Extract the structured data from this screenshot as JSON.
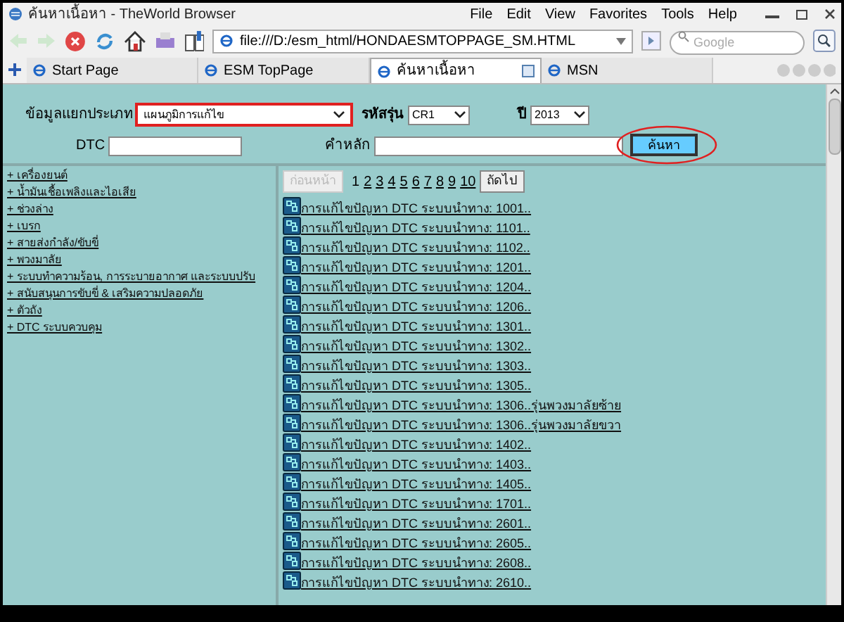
{
  "window": {
    "title": "ค้นหาเนื้อหา - TheWorld Browser"
  },
  "menu": [
    "File",
    "Edit",
    "View",
    "Favorites",
    "Tools",
    "Help"
  ],
  "address": {
    "value": "file:///D:/esm_html/HONDAESMTOPPAGE_SM.HTML"
  },
  "search": {
    "placeholder": "Google"
  },
  "tabs": [
    {
      "label": "Start Page",
      "selected": false
    },
    {
      "label": "ESM TopPage",
      "selected": false
    },
    {
      "label": "ค้นหาเนื้อหา",
      "selected": true
    },
    {
      "label": "MSN",
      "selected": false
    }
  ],
  "form": {
    "category_label": "ข้อมูลแยกประเภท",
    "category_value": "แผนภูมิการแก้ไข",
    "model_label": "รหัสรุ่น",
    "model_value": "CR1",
    "year_label": "ปี",
    "year_value": "2013",
    "dtc_label": "DTC",
    "keyword_label": "คำหลัก",
    "search_button": "ค้นหา"
  },
  "sidebar": {
    "items": [
      "+ เครื่องยนต์",
      "+ น้ำมันเชื้อเพลิงและไอเสีย",
      "+ ช่วงล่าง",
      "+ เบรก",
      "+ สายส่งกำลัง/ขับขี่",
      "+ พวงมาลัย",
      "+ ระบบทำความร้อน, การระบายอากาศ และระบบปรับ",
      "+ สนับสนุนการขับขี่ & เสริมความปลอดภัย",
      "+ ตัวถัง",
      "+ DTC ระบบควบคุม"
    ]
  },
  "pagination": {
    "prev": {
      "label": "ก่อนหน้า",
      "disabled": true
    },
    "pages": [
      "1",
      "2",
      "3",
      "4",
      "5",
      "6",
      "7",
      "8",
      "9",
      "10"
    ],
    "next": {
      "label": "ถัดไป",
      "disabled": false
    }
  },
  "results": [
    "การแก้ไขปัญหา DTC ระบบนำทาง: 1001..",
    "การแก้ไขปัญหา DTC ระบบนำทาง: 1101..",
    "การแก้ไขปัญหา DTC ระบบนำทาง: 1102..",
    "การแก้ไขปัญหา DTC ระบบนำทาง: 1201..",
    "การแก้ไขปัญหา DTC ระบบนำทาง: 1204..",
    "การแก้ไขปัญหา DTC ระบบนำทาง: 1206..",
    "การแก้ไขปัญหา DTC ระบบนำทาง: 1301..",
    "การแก้ไขปัญหา DTC ระบบนำทาง: 1302..",
    "การแก้ไขปัญหา DTC ระบบนำทาง: 1303..",
    "การแก้ไขปัญหา DTC ระบบนำทาง: 1305..",
    "การแก้ไขปัญหา DTC ระบบนำทาง: 1306..รุ่นพวงมาลัยซ้าย",
    "การแก้ไขปัญหา DTC ระบบนำทาง: 1306..รุ่นพวงมาลัยขวา",
    "การแก้ไขปัญหา DTC ระบบนำทาง: 1402..",
    "การแก้ไขปัญหา DTC ระบบนำทาง: 1403..",
    "การแก้ไขปัญหา DTC ระบบนำทาง: 1405..",
    "การแก้ไขปัญหา DTC ระบบนำทาง: 1701..",
    "การแก้ไขปัญหา DTC ระบบนำทาง: 2601..",
    "การแก้ไขปัญหา DTC ระบบนำทาง: 2605..",
    "การแก้ไขปัญหา DTC ระบบนำทาง: 2608..",
    "การแก้ไขปัญหา DTC ระบบนำทาง: 2610.."
  ]
}
